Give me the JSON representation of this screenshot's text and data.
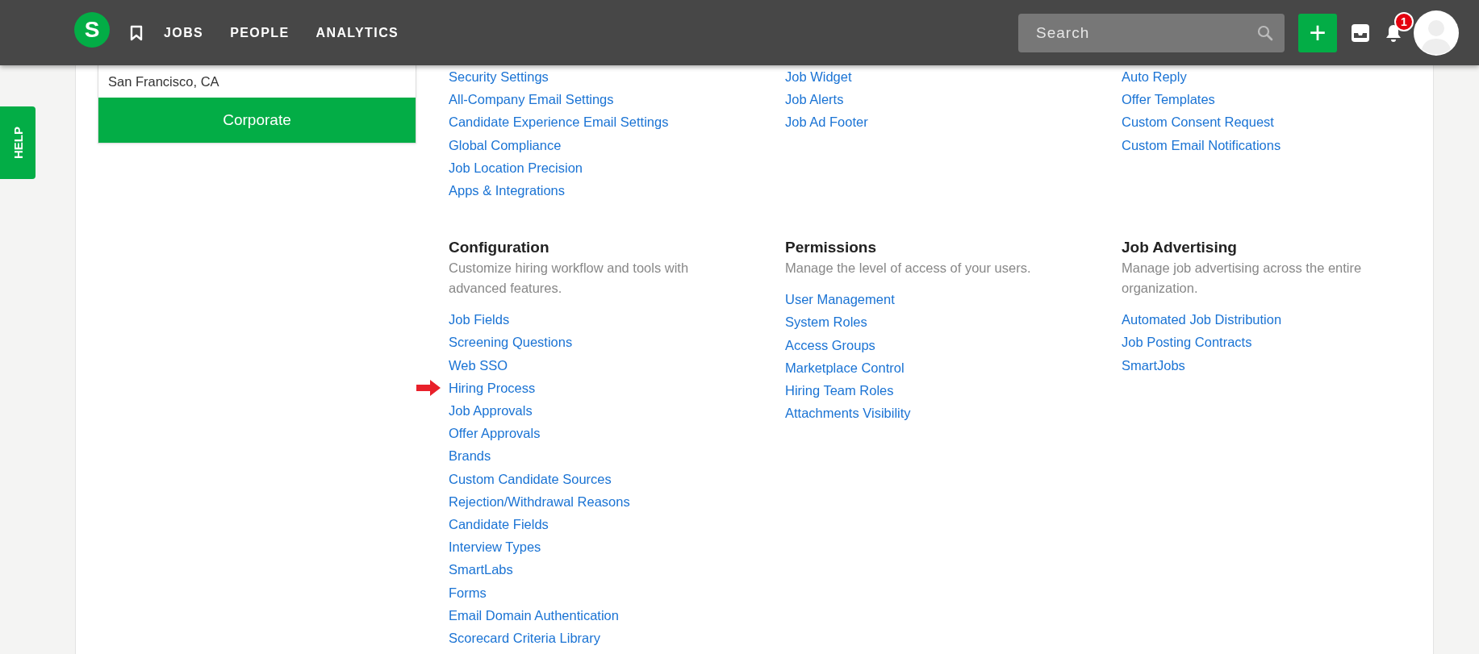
{
  "nav": {
    "items": [
      {
        "label": "JOBS"
      },
      {
        "label": "PEOPLE"
      },
      {
        "label": "ANALYTICS"
      }
    ],
    "logo": "S",
    "search": {
      "placeholder": "Search"
    },
    "add": "+",
    "notifications": "1"
  },
  "help": "HELP",
  "card": {
    "location": "San Francisco, CA",
    "button": "Corporate"
  },
  "sections": [
    {
      "links": [
        {
          "label": "Security Settings"
        },
        {
          "label": "All-Company Email Settings"
        },
        {
          "label": "Candidate Experience Email Settings"
        },
        {
          "label": "Global Compliance"
        },
        {
          "label": "Job Location Precision"
        },
        {
          "label": "Apps & Integrations"
        }
      ]
    },
    {
      "links": [
        {
          "label": "Job Widget"
        },
        {
          "label": "Job Alerts"
        },
        {
          "label": "Job Ad Footer"
        }
      ]
    },
    {
      "links": [
        {
          "label": "Auto Reply"
        },
        {
          "label": "Offer Templates"
        },
        {
          "label": "Custom Consent Request"
        },
        {
          "label": "Custom Email Notifications"
        }
      ]
    },
    {
      "title": "Configuration",
      "description": "Customize hiring workflow and tools with advanced features.",
      "links": [
        {
          "label": "Job Fields",
          "highlighted": false
        },
        {
          "label": "Screening Questions",
          "highlighted": false
        },
        {
          "label": "Web SSO",
          "highlighted": false
        },
        {
          "label": "Hiring Process",
          "highlighted": true
        },
        {
          "label": "Job Approvals",
          "highlighted": false
        },
        {
          "label": "Offer Approvals",
          "highlighted": false
        },
        {
          "label": "Brands",
          "highlighted": false
        },
        {
          "label": "Custom Candidate Sources",
          "highlighted": false
        },
        {
          "label": "Rejection/Withdrawal Reasons",
          "highlighted": false
        },
        {
          "label": "Candidate Fields",
          "highlighted": false
        },
        {
          "label": "Interview Types",
          "highlighted": false
        },
        {
          "label": "SmartLabs",
          "highlighted": false
        },
        {
          "label": "Forms",
          "highlighted": false
        },
        {
          "label": "Email Domain Authentication",
          "highlighted": false
        },
        {
          "label": "Scorecard Criteria Library",
          "highlighted": false
        }
      ]
    },
    {
      "title": "Permissions",
      "description": "Manage the level of access of your users.",
      "links": [
        {
          "label": "User Management"
        },
        {
          "label": "System Roles"
        },
        {
          "label": "Access Groups"
        },
        {
          "label": "Marketplace Control"
        },
        {
          "label": "Hiring Team Roles"
        },
        {
          "label": "Attachments Visibility"
        }
      ]
    },
    {
      "title": "Job Advertising",
      "description": "Manage job advertising across the entire organization.",
      "links": [
        {
          "label": "Automated Job Distribution"
        },
        {
          "label": "Job Posting Contracts"
        },
        {
          "label": "SmartJobs"
        }
      ]
    }
  ]
}
